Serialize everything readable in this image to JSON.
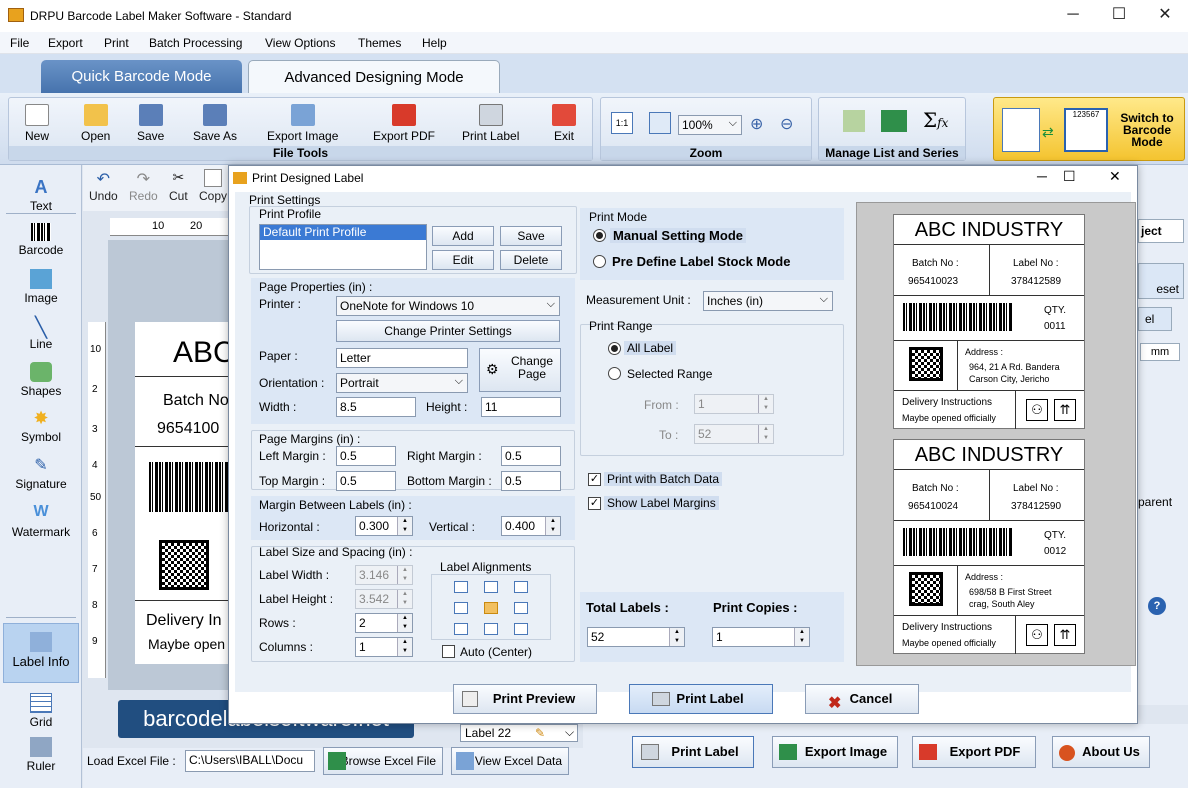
{
  "window": {
    "title": "DRPU Barcode Label Maker Software - Standard"
  },
  "menu": [
    "File",
    "Export",
    "Print",
    "Batch Processing",
    "View Options",
    "Themes",
    "Help"
  ],
  "modes": {
    "quick": "Quick Barcode Mode",
    "advanced": "Advanced Designing Mode"
  },
  "file_tools": {
    "label": "File Tools",
    "buttons": [
      "New",
      "Open",
      "Save",
      "Save As",
      "Export Image",
      "Export PDF",
      "Print Label",
      "Exit"
    ]
  },
  "zoom": {
    "label": "Zoom",
    "value": "100%"
  },
  "manage": {
    "label": "Manage List and Series"
  },
  "switch": {
    "label": "Switch to Barcode Mode",
    "code": "123567"
  },
  "left_tools": [
    "Text",
    "Barcode",
    "Image",
    "Line",
    "Shapes",
    "Symbol",
    "Signature",
    "Watermark",
    "Label Info",
    "Grid",
    "Ruler"
  ],
  "edit_tools": [
    "Undo",
    "Redo",
    "Cut",
    "Copy"
  ],
  "ruler": {
    "h": [
      "10",
      "20"
    ],
    "v": [
      "10",
      "2",
      "3",
      "4",
      "50",
      "6",
      "7",
      "8",
      "9"
    ]
  },
  "canvas_label": {
    "title": "ABC",
    "batch": "Batch No",
    "batch_value": "9654100",
    "delivery": "Delivery In",
    "maybe": "Maybe open"
  },
  "right_partial": {
    "ject": "ject",
    "eset": "eset",
    "el": "el",
    "mm": "mm",
    "parent": "parent"
  },
  "footer": {
    "load_excel": "Load Excel File :",
    "path": "C:\\Users\\IBALL\\Docu",
    "browse": "Browse Excel File",
    "view": "View Excel Data",
    "label_sel": "Label 22"
  },
  "bottom_buttons": [
    "Print Label",
    "Export Image",
    "Export PDF",
    "About Us"
  ],
  "brand": "barcodelabelsoftware.net",
  "dialog": {
    "title": "Print Designed Label",
    "print_settings": "Print Settings",
    "print_profile": "Print Profile",
    "profile_item": "Default Print Profile",
    "profile_buttons": [
      "Add",
      "Save",
      "Edit",
      "Delete"
    ],
    "page_properties": "Page Properties (in) :",
    "printer_label": "Printer :",
    "printer_value": "OneNote for Windows 10",
    "change_printer": "Change Printer Settings",
    "paper_label": "Paper :",
    "paper_value": "Letter",
    "orientation_label": "Orientation :",
    "orientation_value": "Portrait",
    "change_page": "Change Page",
    "width_label": "Width :",
    "width_value": "8.5",
    "height_label": "Height :",
    "height_value": "11",
    "page_margins": "Page Margins (in) :",
    "left_margin_label": "Left Margin :",
    "left_margin": "0.5",
    "right_margin_label": "Right Margin :",
    "right_margin": "0.5",
    "top_margin_label": "Top Margin :",
    "top_margin": "0.5",
    "bottom_margin_label": "Bottom Margin :",
    "bottom_margin": "0.5",
    "margin_between": "Margin Between Labels (in) :",
    "horizontal_label": "Horizontal :",
    "horizontal": "0.300",
    "vertical_label": "Vertical :",
    "vertical": "0.400",
    "label_size": "Label Size and Spacing (in) :",
    "label_width_label": "Label Width :",
    "label_width": "3.146",
    "label_height_label": "Label Height :",
    "label_height": "3.542",
    "rows_label": "Rows :",
    "rows": "2",
    "columns_label": "Columns :",
    "columns": "1",
    "label_alignments": "Label Alignments",
    "auto_center": "Auto (Center)",
    "print_mode": "Print Mode",
    "manual_mode": "Manual Setting Mode",
    "predefine_mode": "Pre Define Label Stock Mode",
    "measurement_label": "Measurement Unit :",
    "measurement_value": "Inches (in)",
    "print_range": "Print Range",
    "all_label": "All Label",
    "selected_range": "Selected Range",
    "from_label": "From :",
    "from_value": "1",
    "to_label": "To :",
    "to_value": "52",
    "print_batch": "Print with Batch Data",
    "show_margins": "Show Label Margins",
    "total_labels_label": "Total Labels :",
    "total_labels": "52",
    "print_copies_label": "Print Copies :",
    "print_copies": "1",
    "buttons": {
      "preview": "Print Preview",
      "print": "Print Label",
      "cancel": "Cancel"
    }
  },
  "preview_labels": [
    {
      "title": "ABC INDUSTRY",
      "batch_label": "Batch No :",
      "batch": "965410023",
      "label_no_label": "Label No :",
      "label_no": "378412589",
      "qty_label": "QTY.",
      "qty": "0011",
      "address_label": "Address :",
      "address1": "964, 21 A Rd. Bandera",
      "address2": "Carson City, Jericho",
      "delivery": "Delivery Instructions",
      "maybe": "Maybe opened officially"
    },
    {
      "title": "ABC INDUSTRY",
      "batch_label": "Batch No :",
      "batch": "965410024",
      "label_no_label": "Label No :",
      "label_no": "378412590",
      "qty_label": "QTY.",
      "qty": "0012",
      "address_label": "Address :",
      "address1": "698/58 B First Street",
      "address2": "crag, South Aley",
      "delivery": "Delivery Instructions",
      "maybe": "Maybe opened officially"
    }
  ]
}
